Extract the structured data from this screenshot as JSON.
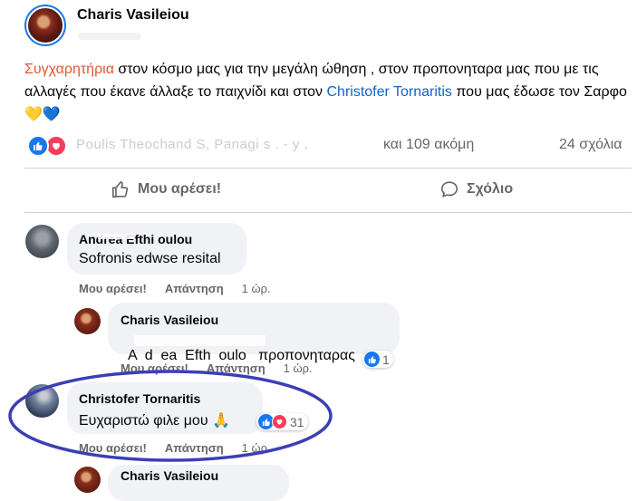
{
  "post": {
    "author": "Charis Vasileiou",
    "text_hashtag": "Συγχαρητήρια",
    "text_part1": " στον κόσμο μας για την μεγάλη ώθηση , στον προπονηταρα  μας που με τις αλλαγές που έκανε άλλαξε το παιχνίδι και στον ",
    "text_mention": "Christofer Tornaritis",
    "text_part2": " που μας έδωσε τον Σαρφο ",
    "text_emoji": "💛💙",
    "reacted_names": "Poulis Theochand  S, Panagi  s  . - y ,",
    "reacted_more": "και 109 ακόμη",
    "comment_count": "24 σχόλια",
    "like_action": "Μου αρέσει!",
    "comment_action": "Σχόλιο"
  },
  "comments": [
    {
      "author": "Andrea  Efthi  oulou",
      "text": "Sofronis edwse resital",
      "like_label": "Μου αρέσει!",
      "reply_label": "Απάντηση",
      "time": "1 ώρ."
    },
    {
      "author": "Charis Vasileiou",
      "text_prefix": "A  d  ea  Efth  oulo  ",
      "text": " προπονηταρας",
      "like_label": "Μου αρέσει!",
      "reply_label": "Απάντηση",
      "time": "1 ώρ.",
      "reaction_count": "1"
    },
    {
      "author": "Christofer Tornaritis",
      "text": "Ευχαριστώ φιλε μου ",
      "emoji": "🙏",
      "like_label": "Μου αρέσει!",
      "reply_label": "Απάντηση",
      "time": "1 ώρ.",
      "reaction_count": "31"
    },
    {
      "author": "Charis Vasileiou"
    }
  ],
  "colors": {
    "hashtag": "#e4572e",
    "mention": "#1464c8",
    "like_blue": "#1877f2",
    "love_red": "#f33e58",
    "annotation": "#3b3fb5"
  },
  "icons": [
    "thumbs-up-icon",
    "heart-icon",
    "comment-bubble-icon",
    "pray-emoji",
    "heart-emoji"
  ]
}
